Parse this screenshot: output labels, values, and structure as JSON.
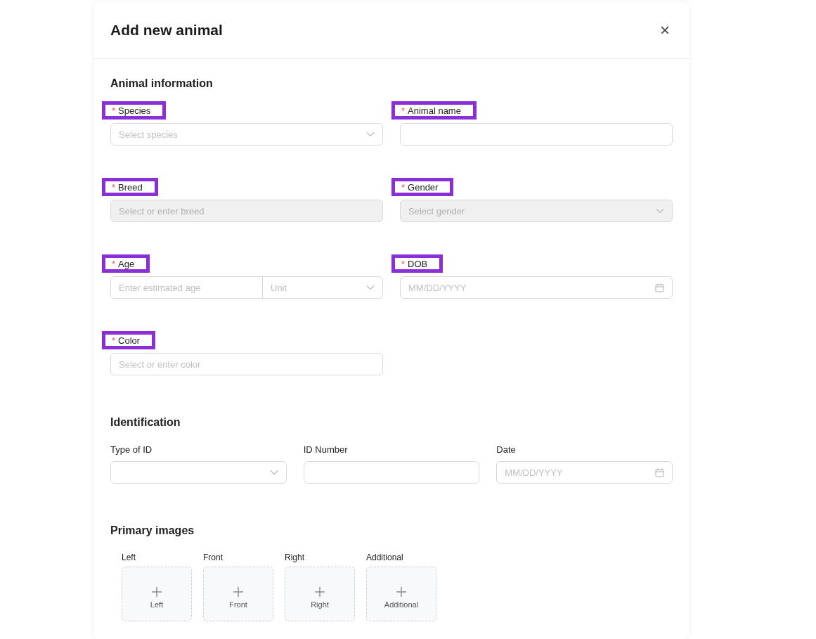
{
  "header": {
    "title": "Add new animal",
    "close": "×"
  },
  "sections": [
    {
      "title": "Animal information",
      "fields": [
        {
          "label": "Species",
          "required_mark": "*",
          "highlighted": true,
          "kind": "select",
          "placeholder": "Select species",
          "disabled": false
        },
        {
          "label": "Animal name",
          "required_mark": "*",
          "highlighted": true,
          "kind": "text",
          "disabled": false
        },
        {
          "label": "Breed",
          "required_mark": "*",
          "highlighted": true,
          "kind": "text",
          "placeholder": "Select or enter breed",
          "disabled": true
        },
        {
          "label": "Gender",
          "required_mark": "*",
          "highlighted": true,
          "kind": "select",
          "placeholder": "Select gender",
          "disabled": true
        },
        {
          "label": "Age",
          "required_mark": "*",
          "highlighted": true,
          "kind": "age",
          "placeholder": "Enter estimated age",
          "unit_placeholder": "Unit",
          "disabled": false
        },
        {
          "label": "DOB",
          "required_mark": "*",
          "highlighted": true,
          "kind": "date",
          "placeholder": "MM/DD/YYYY",
          "disabled": false
        },
        {
          "label": "Color",
          "required_mark": "*",
          "highlighted": true,
          "kind": "text",
          "placeholder": "Select or enter color",
          "disabled": false
        }
      ]
    },
    {
      "title": "Identification",
      "fields": [
        {
          "label": "Type of ID",
          "highlighted": false,
          "kind": "select",
          "disabled": false
        },
        {
          "label": "ID Number",
          "highlighted": false,
          "kind": "text",
          "disabled": false
        },
        {
          "label": "Date",
          "highlighted": false,
          "kind": "date",
          "placeholder": "MM/DD/YYYY",
          "disabled": false
        }
      ]
    }
  ],
  "images": {
    "title": "Primary images",
    "slots": [
      {
        "label": "Left",
        "caption": "Left"
      },
      {
        "label": "Front",
        "caption": "Front"
      },
      {
        "label": "Right",
        "caption": "Right"
      },
      {
        "label": "Additional",
        "caption": "Additional"
      }
    ]
  }
}
